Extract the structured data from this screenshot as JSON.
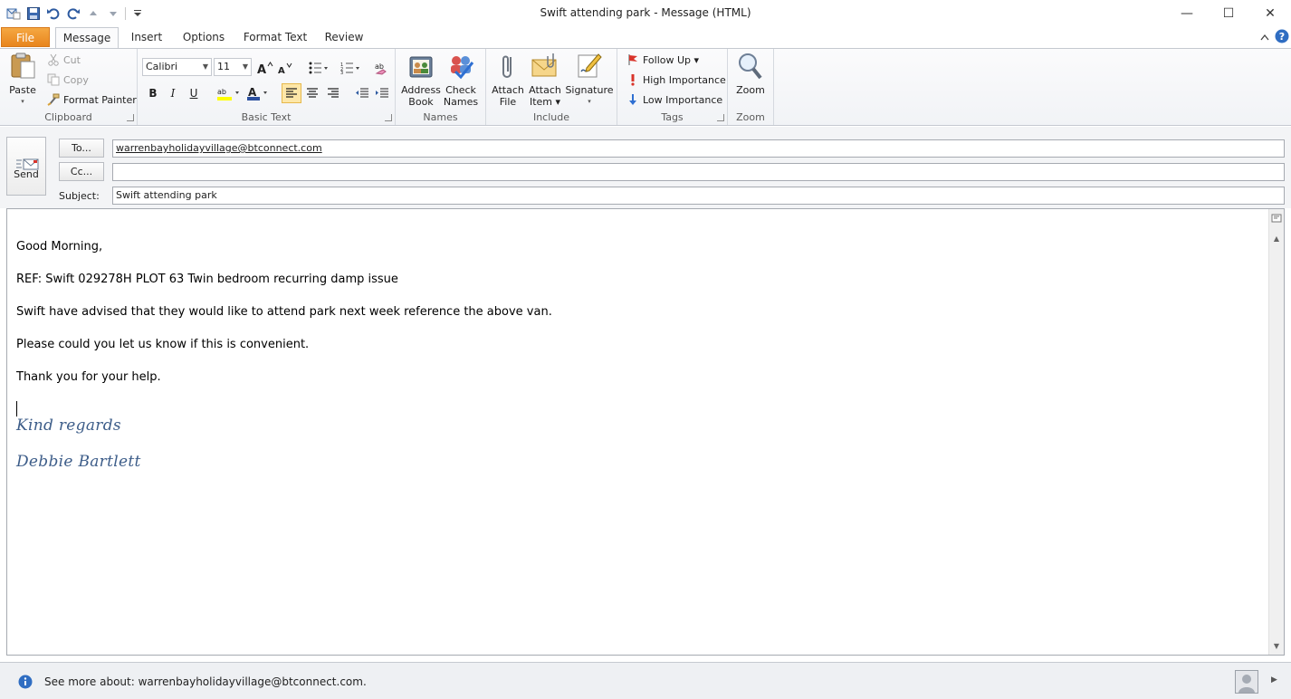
{
  "window": {
    "title": "Swift attending park  -  Message (HTML)",
    "minimize": "—",
    "maximize": "☐",
    "close": "✕"
  },
  "tabs": {
    "file": "File",
    "message": "Message",
    "insert": "Insert",
    "options": "Options",
    "format_text": "Format Text",
    "review": "Review"
  },
  "ribbon": {
    "clipboard": {
      "label": "Clipboard",
      "paste": "Paste",
      "cut": "Cut",
      "copy": "Copy",
      "format_painter": "Format Painter"
    },
    "basic_text": {
      "label": "Basic Text",
      "font": "Calibri",
      "size": "11",
      "bold": "B",
      "italic": "I",
      "underline": "U"
    },
    "names": {
      "label": "Names",
      "address_book_1": "Address",
      "address_book_2": "Book",
      "check_names_1": "Check",
      "check_names_2": "Names"
    },
    "include": {
      "label": "Include",
      "attach_file_1": "Attach",
      "attach_file_2": "File",
      "attach_item_1": "Attach",
      "attach_item_2": "Item ▾",
      "signature": "Signature"
    },
    "tags": {
      "label": "Tags",
      "follow_up": "Follow Up ▾",
      "high_importance": "High Importance",
      "low_importance": "Low Importance"
    },
    "zoom": {
      "label": "Zoom",
      "zoom": "Zoom"
    }
  },
  "compose": {
    "send": "Send",
    "to_button": "To...",
    "cc_button": "Cc...",
    "subject_label": "Subject:",
    "to_value": "warrenbayholidayvillage@btconnect.com",
    "cc_value": "",
    "subject_value": "Swift attending park"
  },
  "body": {
    "greeting": "Good Morning,",
    "ref": "REF: Swift 029278H PLOT 63 Twin bedroom recurring damp issue",
    "line1": "Swift have advised that they would like to attend park next week reference the above van.",
    "line2": "Please could you let us know if this is convenient.",
    "thanks": "Thank you for your help.",
    "sig_regards": "Kind regards",
    "sig_name": "Debbie Bartlett"
  },
  "people_pane": {
    "text": "See more about: warrenbayholidayvillage@btconnect.com."
  },
  "colors": {
    "file_tab": "#e8851e",
    "signature": "#3d5d89",
    "accent": "#2b579a"
  }
}
